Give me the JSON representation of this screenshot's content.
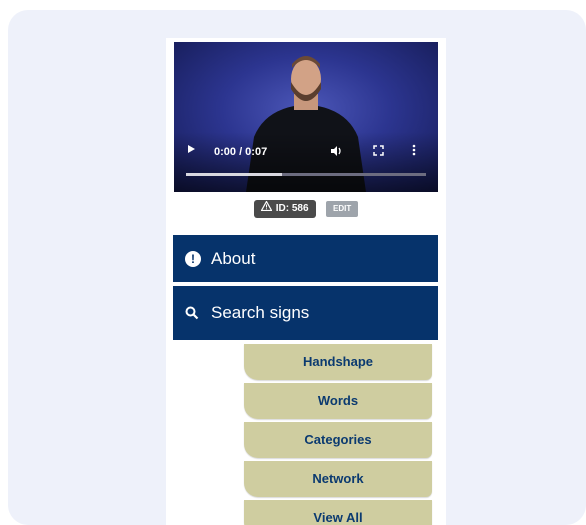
{
  "video": {
    "time": "0:00 / 0:07",
    "progress_fraction": 0.4,
    "icons": [
      "play-icon",
      "volume-icon",
      "fullscreen-icon",
      "more-vertical-icon"
    ]
  },
  "badge": {
    "id_label": "ID: 586",
    "edit_label": "EDIT"
  },
  "nav": {
    "about_label": "About",
    "search_label": "Search signs"
  },
  "submenu": {
    "items": [
      {
        "label": "Handshape"
      },
      {
        "label": "Words"
      },
      {
        "label": "Categories"
      },
      {
        "label": "Network"
      },
      {
        "label": "View All"
      }
    ]
  },
  "colors": {
    "nav_bg": "#06336b",
    "submenu_bg": "#cfcda0",
    "submenu_text": "#0b3a70"
  }
}
